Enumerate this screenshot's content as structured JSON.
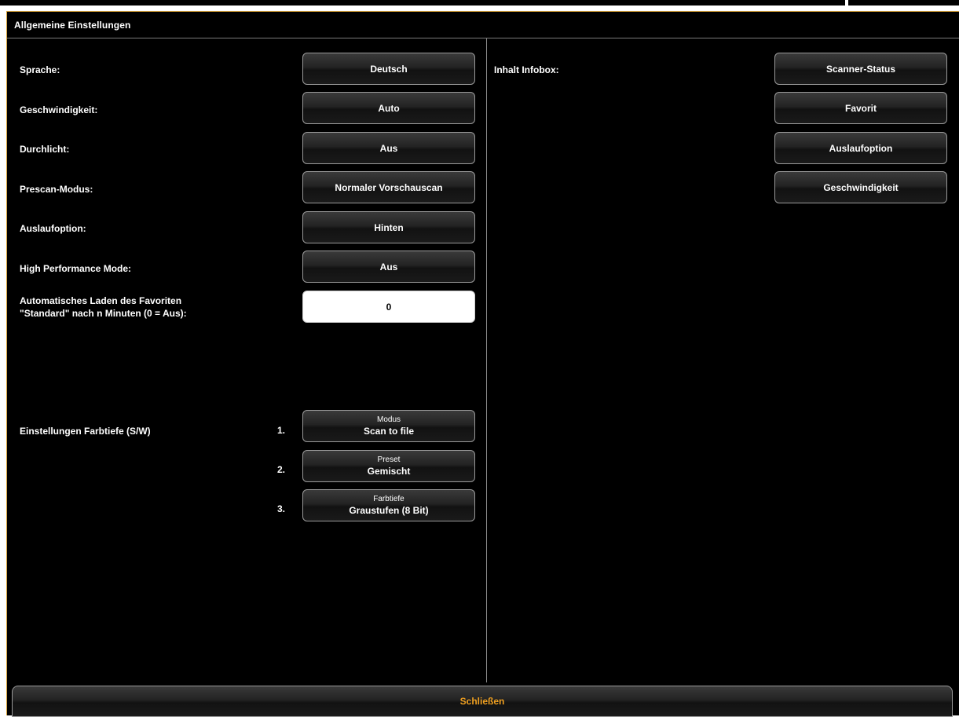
{
  "header": {
    "title": "Allgemeine Einstellungen"
  },
  "left": {
    "settings": [
      {
        "label": "Sprache:",
        "value": "Deutsch"
      },
      {
        "label": "Geschwindigkeit:",
        "value": "Auto"
      },
      {
        "label": "Durchlicht:",
        "value": "Aus"
      },
      {
        "label": "Prescan-Modus:",
        "value": "Normaler Vorschauscan"
      },
      {
        "label": "Auslaufoption:",
        "value": "Hinten"
      },
      {
        "label": "High Performance Mode:",
        "value": "Aus"
      }
    ],
    "autoload": {
      "label_line1": "Automatisches Laden des Favoriten",
      "label_line2": "\"Standard\" nach n Minuten (0 = Aus):",
      "value": "0"
    },
    "color_depth": {
      "label": "Einstellungen Farbtiefe (S/W)",
      "items": [
        {
          "number": "1.",
          "caption": "Modus",
          "value": "Scan to file"
        },
        {
          "number": "2.",
          "caption": "Preset",
          "value": "Gemischt"
        },
        {
          "number": "3.",
          "caption": "Farbtiefe",
          "value": "Graustufen (8 Bit)"
        }
      ]
    }
  },
  "right": {
    "infobox_label": "Inhalt Infobox:",
    "items": [
      "Scanner-Status",
      "Favorit",
      "Auslaufoption",
      "Geschwindigkeit"
    ]
  },
  "footer": {
    "close_label": "Schließen"
  },
  "colors": {
    "accent": "#d9a43a",
    "close_text": "#f0a020",
    "background": "#000000"
  }
}
